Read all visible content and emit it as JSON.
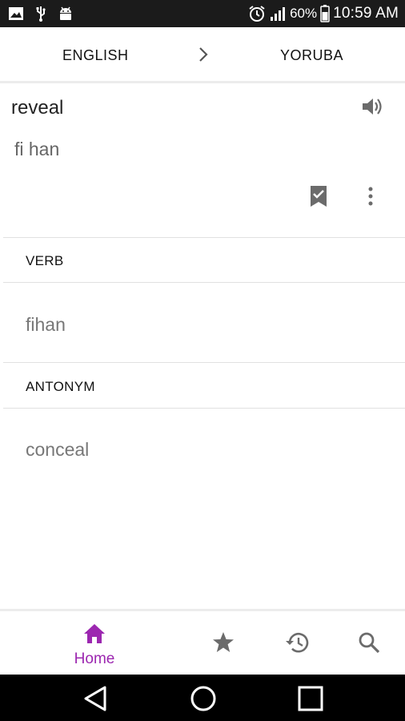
{
  "status_bar": {
    "icons_left": [
      "image-icon",
      "usb-icon",
      "android-icon"
    ],
    "icons_right": [
      "alarm-icon",
      "signal-icon",
      "battery-icon"
    ],
    "battery_percent": "60%",
    "time": "10:59 AM"
  },
  "language_bar": {
    "source": "ENGLISH",
    "target": "YORUBA"
  },
  "entry": {
    "word": "reveal",
    "translation": "fi han"
  },
  "sections": [
    {
      "label": "VERB",
      "value": "fihan"
    },
    {
      "label": "ANTONYM",
      "value": "conceal"
    }
  ],
  "bottom_nav": {
    "home_label": "Home",
    "items": [
      "home-icon",
      "star-icon",
      "history-icon",
      "search-icon"
    ]
  },
  "colors": {
    "accent": "#9c27b0",
    "icon_gray": "#6b6b6b",
    "status_bar": "#1b1b1b"
  }
}
